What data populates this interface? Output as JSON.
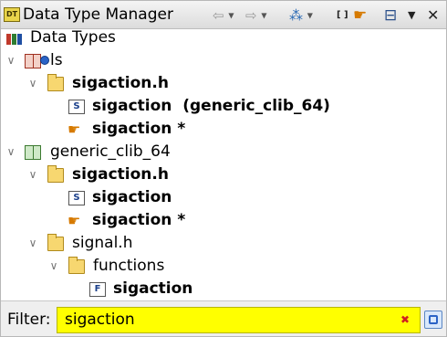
{
  "window": {
    "title": "Data Type Manager",
    "title_icon": "DT"
  },
  "toolbar": {
    "back_icon": "⇦",
    "forward_icon": "⇨",
    "brackets_label": "[ ]",
    "hand_icon": "☛",
    "minimize_icon": "⊟",
    "menu_icon": "▼",
    "close_icon": "✕"
  },
  "tree": {
    "root": {
      "label": "Data Types",
      "toggle": ""
    },
    "rows": [
      {
        "label": "ls",
        "toggle": "∨",
        "bold": false
      },
      {
        "label": "sigaction.h",
        "toggle": "∨",
        "bold": true
      },
      {
        "label": "sigaction  (generic_clib_64)",
        "toggle": "",
        "bold": true
      },
      {
        "label": "sigaction *",
        "toggle": "",
        "bold": true
      },
      {
        "label": "generic_clib_64",
        "toggle": "∨",
        "bold": false
      },
      {
        "label": "sigaction.h",
        "toggle": "∨",
        "bold": true
      },
      {
        "label": "sigaction",
        "toggle": "",
        "bold": true
      },
      {
        "label": "sigaction *",
        "toggle": "",
        "bold": true
      },
      {
        "label": "signal.h",
        "toggle": "∨",
        "bold": false
      },
      {
        "label": "functions",
        "toggle": "∨",
        "bold": false
      },
      {
        "label": "sigaction",
        "toggle": "",
        "bold": true
      }
    ]
  },
  "filter": {
    "label": "Filter:",
    "value": "sigaction",
    "clear_icon": "✖"
  },
  "icons": {
    "struct_file": "S",
    "function_file": "F",
    "pointer": "☛"
  },
  "colors": {
    "filter_bg": "#ffff00",
    "folder": "#f7d770",
    "accent": "#2b63c6"
  }
}
